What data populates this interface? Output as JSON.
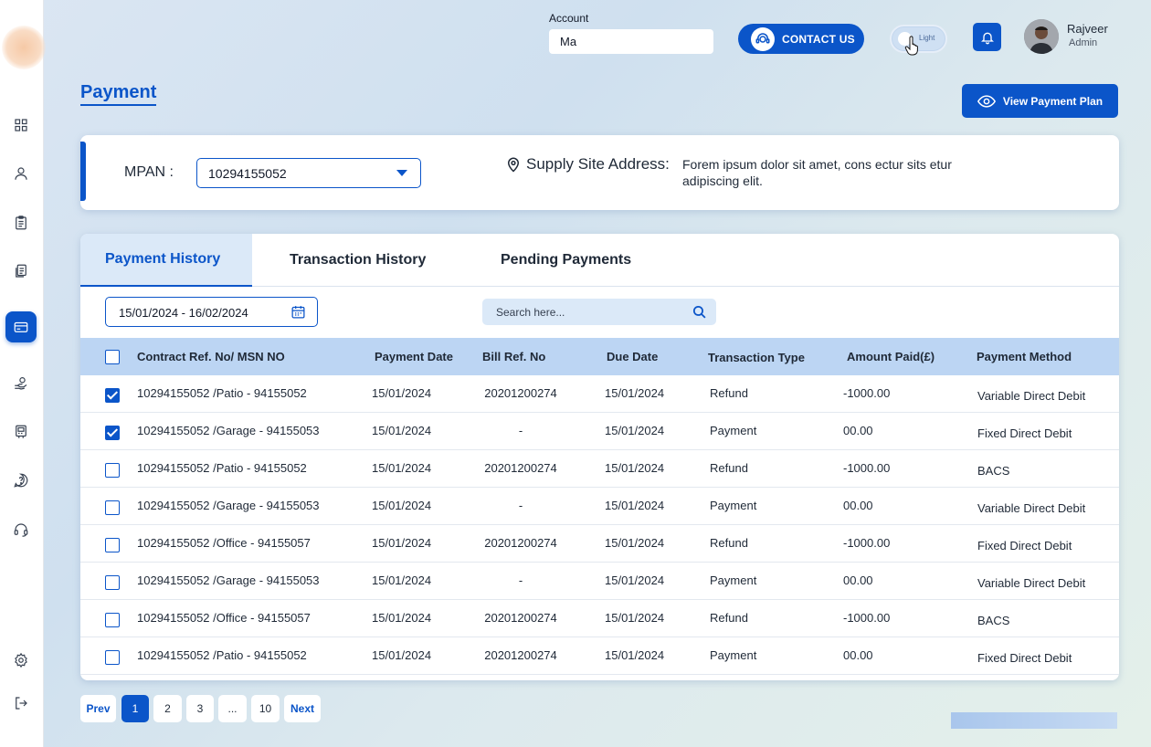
{
  "header": {
    "account_label": "Account",
    "account_value": "Ma",
    "contact_label": "CONTACT US",
    "theme_label": "Light",
    "user_name": "Rajveer",
    "user_role": "Admin"
  },
  "page": {
    "title": "Payment",
    "view_plan_label": "View Payment Plan"
  },
  "mpan": {
    "label": "MPAN :",
    "value": "10294155052",
    "supply_label": "Supply Site Address:",
    "supply_value": "Forem ipsum dolor sit amet, cons ectur sits etur adipiscing elit."
  },
  "tabs": [
    {
      "label": "Payment History",
      "active": true
    },
    {
      "label": "Transaction  History",
      "active": false
    },
    {
      "label": "Pending Payments",
      "active": false
    }
  ],
  "filters": {
    "date_range": "15/01/2024 - 16/02/2024",
    "search_placeholder": "Search here..."
  },
  "table": {
    "columns": [
      "Contract Ref. No/ MSN NO",
      "Payment Date",
      "Bill Ref. No",
      "Due Date",
      "Transaction Type",
      "Amount Paid(£)",
      "Payment Method"
    ],
    "rows": [
      {
        "checked": true,
        "contract": "10294155052 /Patio - 94155052",
        "payment_date": "15/01/2024",
        "bill_ref": "20201200274",
        "due_date": "15/01/2024",
        "type": "Refund",
        "amount": "-1000.00",
        "method": "Variable Direct Debit"
      },
      {
        "checked": true,
        "contract": "10294155052 /Garage - 94155053",
        "payment_date": "15/01/2024",
        "bill_ref": "-",
        "due_date": "15/01/2024",
        "type": "Payment",
        "amount": "00.00",
        "method": "Fixed Direct Debit"
      },
      {
        "checked": false,
        "contract": "10294155052 /Patio - 94155052",
        "payment_date": "15/01/2024",
        "bill_ref": "20201200274",
        "due_date": "15/01/2024",
        "type": "Refund",
        "amount": "-1000.00",
        "method": "BACS"
      },
      {
        "checked": false,
        "contract": "10294155052 /Garage - 94155053",
        "payment_date": "15/01/2024",
        "bill_ref": "-",
        "due_date": "15/01/2024",
        "type": "Payment",
        "amount": "00.00",
        "method": "Variable Direct Debit"
      },
      {
        "checked": false,
        "contract": "10294155052 /Office - 94155057",
        "payment_date": "15/01/2024",
        "bill_ref": "20201200274",
        "due_date": "15/01/2024",
        "type": "Refund",
        "amount": "-1000.00",
        "method": "Fixed Direct Debit"
      },
      {
        "checked": false,
        "contract": "10294155052 /Garage - 94155053",
        "payment_date": "15/01/2024",
        "bill_ref": "-",
        "due_date": "15/01/2024",
        "type": "Payment",
        "amount": "00.00",
        "method": "Variable Direct Debit"
      },
      {
        "checked": false,
        "contract": "10294155052 /Office - 94155057",
        "payment_date": "15/01/2024",
        "bill_ref": "20201200274",
        "due_date": "15/01/2024",
        "type": "Refund",
        "amount": "-1000.00",
        "method": "BACS"
      },
      {
        "checked": false,
        "contract": "10294155052 /Patio - 94155052",
        "payment_date": "15/01/2024",
        "bill_ref": "20201200274",
        "due_date": "15/01/2024",
        "type": "Payment",
        "amount": "00.00",
        "method": "Fixed Direct Debit"
      }
    ]
  },
  "pagination": {
    "prev": "Prev",
    "pages": [
      "1",
      "2",
      "3",
      "...",
      "10"
    ],
    "current": "1",
    "next": "Next"
  },
  "sidebar": {
    "items": [
      {
        "icon": "grid-icon",
        "active": false
      },
      {
        "icon": "user-icon",
        "active": false
      },
      {
        "icon": "clipboard-icon",
        "active": false
      },
      {
        "icon": "documents-icon",
        "active": false
      },
      {
        "icon": "credit-card-icon",
        "active": true
      },
      {
        "icon": "hand-coin-icon",
        "active": false
      },
      {
        "icon": "meter-icon",
        "active": false
      },
      {
        "icon": "help-icon",
        "active": false
      },
      {
        "icon": "headset-icon",
        "active": false
      },
      {
        "icon": "settings-icon",
        "active": false
      },
      {
        "icon": "logout-icon",
        "active": false
      }
    ]
  },
  "colors": {
    "primary": "#0b55c9",
    "tab_active_bg": "#dbe9f8",
    "table_header_bg": "#bcd5f3"
  }
}
